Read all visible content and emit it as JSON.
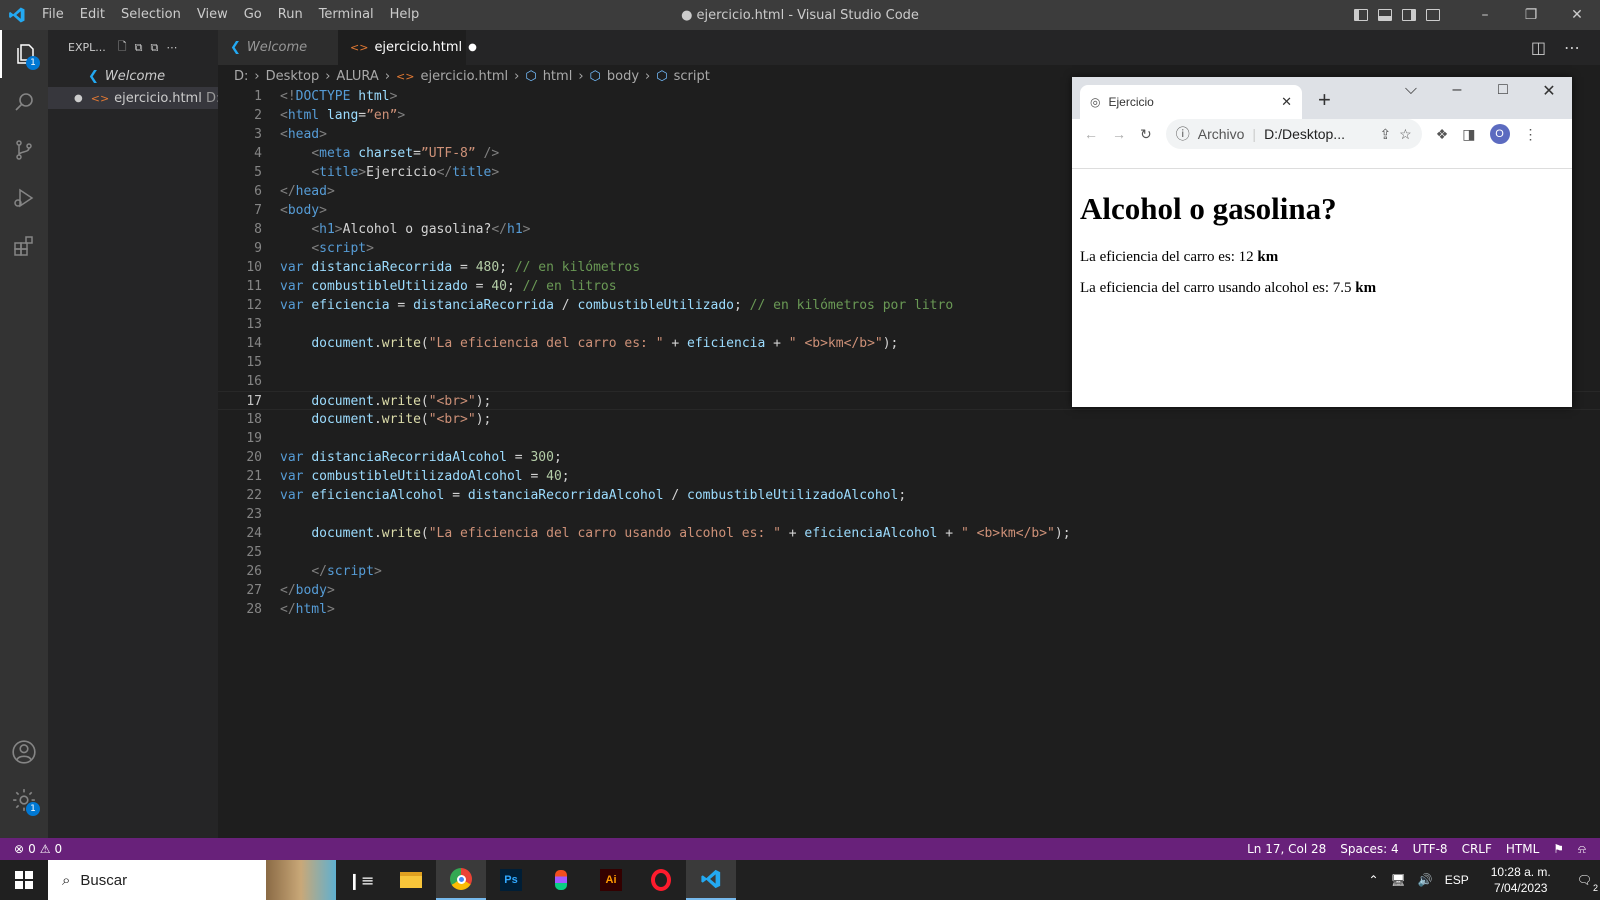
{
  "menu": [
    "File",
    "Edit",
    "Selection",
    "View",
    "Go",
    "Run",
    "Terminal",
    "Help"
  ],
  "window_title": "● ejercicio.html - Visual Studio Code",
  "explorer": {
    "header": "EXPL...",
    "open_file": "ejercicio.html",
    "open_file_path": "D:..."
  },
  "tabs": [
    {
      "label": "Welcome"
    },
    {
      "label": "ejercicio.html"
    }
  ],
  "breadcrumb": [
    "D:",
    "Desktop",
    "ALURA",
    "ejercicio.html",
    "html",
    "body",
    "script"
  ],
  "badges": {
    "explorer": "1",
    "settings": "1"
  },
  "current_line": 17,
  "code_lines": [
    [
      [
        "tp",
        "<!"
      ],
      [
        "tg",
        "DOCTYPE"
      ],
      [
        "at",
        " html"
      ],
      [
        "tp",
        ">"
      ]
    ],
    [
      [
        "tp",
        "<"
      ],
      [
        "tg",
        "html"
      ],
      [
        "at",
        " lang"
      ],
      [
        "tx",
        "="
      ],
      [
        "st",
        "”en”"
      ],
      [
        "tp",
        ">"
      ]
    ],
    [
      [
        "tp",
        "<"
      ],
      [
        "tg",
        "head"
      ],
      [
        "tp",
        ">"
      ]
    ],
    [
      [
        "tx",
        "    "
      ],
      [
        "tp",
        "<"
      ],
      [
        "tg",
        "meta"
      ],
      [
        "at",
        " charset"
      ],
      [
        "tx",
        "="
      ],
      [
        "st",
        "”UTF-8”"
      ],
      [
        "tp",
        " />"
      ]
    ],
    [
      [
        "tx",
        "    "
      ],
      [
        "tp",
        "<"
      ],
      [
        "tg",
        "title"
      ],
      [
        "tp",
        ">"
      ],
      [
        "tx",
        "Ejercicio"
      ],
      [
        "tp",
        "</"
      ],
      [
        "tg",
        "title"
      ],
      [
        "tp",
        ">"
      ]
    ],
    [
      [
        "tp",
        "</"
      ],
      [
        "tg",
        "head"
      ],
      [
        "tp",
        ">"
      ]
    ],
    [
      [
        "tp",
        "<"
      ],
      [
        "tg",
        "body"
      ],
      [
        "tp",
        ">"
      ]
    ],
    [
      [
        "tx",
        "    "
      ],
      [
        "tp",
        "<"
      ],
      [
        "tg",
        "h1"
      ],
      [
        "tp",
        ">"
      ],
      [
        "tx",
        "Alcohol o gasolina?"
      ],
      [
        "tp",
        "</"
      ],
      [
        "tg",
        "h1"
      ],
      [
        "tp",
        ">"
      ]
    ],
    [
      [
        "tx",
        "    "
      ],
      [
        "tp",
        "<"
      ],
      [
        "tg",
        "script"
      ],
      [
        "tp",
        ">"
      ]
    ],
    [
      [
        "kw",
        "var "
      ],
      [
        "vr",
        "distanciaRecorrida"
      ],
      [
        "tx",
        " = "
      ],
      [
        "nm",
        "480"
      ],
      [
        "tx",
        "; "
      ],
      [
        "cm",
        "// en kilómetros"
      ]
    ],
    [
      [
        "kw",
        "var "
      ],
      [
        "vr",
        "combustibleUtilizado"
      ],
      [
        "tx",
        " = "
      ],
      [
        "nm",
        "40"
      ],
      [
        "tx",
        "; "
      ],
      [
        "cm",
        "// en litros"
      ]
    ],
    [
      [
        "kw",
        "var "
      ],
      [
        "vr",
        "eficiencia"
      ],
      [
        "tx",
        " = "
      ],
      [
        "vr",
        "distanciaRecorrida"
      ],
      [
        "tx",
        " / "
      ],
      [
        "vr",
        "combustibleUtilizado"
      ],
      [
        "tx",
        "; "
      ],
      [
        "cm",
        "// en kilómetros por litro"
      ]
    ],
    [],
    [
      [
        "tx",
        "    "
      ],
      [
        "vr",
        "document"
      ],
      [
        "tx",
        "."
      ],
      [
        "fn",
        "write"
      ],
      [
        "tx",
        "("
      ],
      [
        "st",
        "\"La eficiencia del carro es: \""
      ],
      [
        "tx",
        " + "
      ],
      [
        "vr",
        "eficiencia"
      ],
      [
        "tx",
        " + "
      ],
      [
        "st",
        "\" <b>km</b>\""
      ],
      [
        "tx",
        ");"
      ]
    ],
    [],
    [],
    [
      [
        "tx",
        "    "
      ],
      [
        "vr",
        "document"
      ],
      [
        "tx",
        "."
      ],
      [
        "fn",
        "write"
      ],
      [
        "tx",
        "("
      ],
      [
        "st",
        "\"<br>\""
      ],
      [
        "tx",
        ");"
      ]
    ],
    [
      [
        "tx",
        "    "
      ],
      [
        "vr",
        "document"
      ],
      [
        "tx",
        "."
      ],
      [
        "fn",
        "write"
      ],
      [
        "tx",
        "("
      ],
      [
        "st",
        "\"<br>\""
      ],
      [
        "tx",
        ");"
      ]
    ],
    [],
    [
      [
        "kw",
        "var "
      ],
      [
        "vr",
        "distanciaRecorridaAlcohol"
      ],
      [
        "tx",
        " = "
      ],
      [
        "nm",
        "300"
      ],
      [
        "tx",
        ";"
      ]
    ],
    [
      [
        "kw",
        "var "
      ],
      [
        "vr",
        "combustibleUtilizadoAlcohol"
      ],
      [
        "tx",
        " = "
      ],
      [
        "nm",
        "40"
      ],
      [
        "tx",
        ";"
      ]
    ],
    [
      [
        "kw",
        "var "
      ],
      [
        "vr",
        "eficienciaAlcohol"
      ],
      [
        "tx",
        " = "
      ],
      [
        "vr",
        "distanciaRecorridaAlcohol"
      ],
      [
        "tx",
        " / "
      ],
      [
        "vr",
        "combustibleUtilizadoAlcohol"
      ],
      [
        "tx",
        ";"
      ]
    ],
    [],
    [
      [
        "tx",
        "    "
      ],
      [
        "vr",
        "document"
      ],
      [
        "tx",
        "."
      ],
      [
        "fn",
        "write"
      ],
      [
        "tx",
        "("
      ],
      [
        "st",
        "\"La eficiencia del carro usando alcohol es: \""
      ],
      [
        "tx",
        " + "
      ],
      [
        "vr",
        "eficienciaAlcohol"
      ],
      [
        "tx",
        " + "
      ],
      [
        "st",
        "\" <b>km</b>\""
      ],
      [
        "tx",
        ");"
      ]
    ],
    [],
    [
      [
        "tx",
        "    "
      ],
      [
        "tp",
        "</"
      ],
      [
        "tg",
        "script"
      ],
      [
        "tp",
        ">"
      ]
    ],
    [
      [
        "tp",
        "</"
      ],
      [
        "tg",
        "body"
      ],
      [
        "tp",
        ">"
      ]
    ],
    [
      [
        "tp",
        "</"
      ],
      [
        "tg",
        "html"
      ],
      [
        "tp",
        ">"
      ]
    ]
  ],
  "status": {
    "errors": "0",
    "warnings": "0",
    "position": "Ln 17, Col 28",
    "spaces": "Spaces: 4",
    "encoding": "UTF-8",
    "eol": "CRLF",
    "language": "HTML"
  },
  "browser": {
    "tab_title": "Ejercicio",
    "protocol": "Archivo",
    "url": "D:/Desktop...",
    "profile": "O",
    "heading": "Alcohol o gasolina?",
    "line1_text": "La eficiencia del carro es: 12 ",
    "line1_unit": "km",
    "line2_text": "La eficiencia del carro usando alcohol es: 7.5 ",
    "line2_unit": "km"
  },
  "taskbar": {
    "search": "Buscar",
    "lang": "ESP",
    "time": "10:28 a. m.",
    "date": "7/04/2023",
    "notifications": "2",
    "apps": [
      "Ps",
      "Ai"
    ]
  },
  "colors": {
    "accent": "#0078d4",
    "statusbar": "#68217a"
  }
}
